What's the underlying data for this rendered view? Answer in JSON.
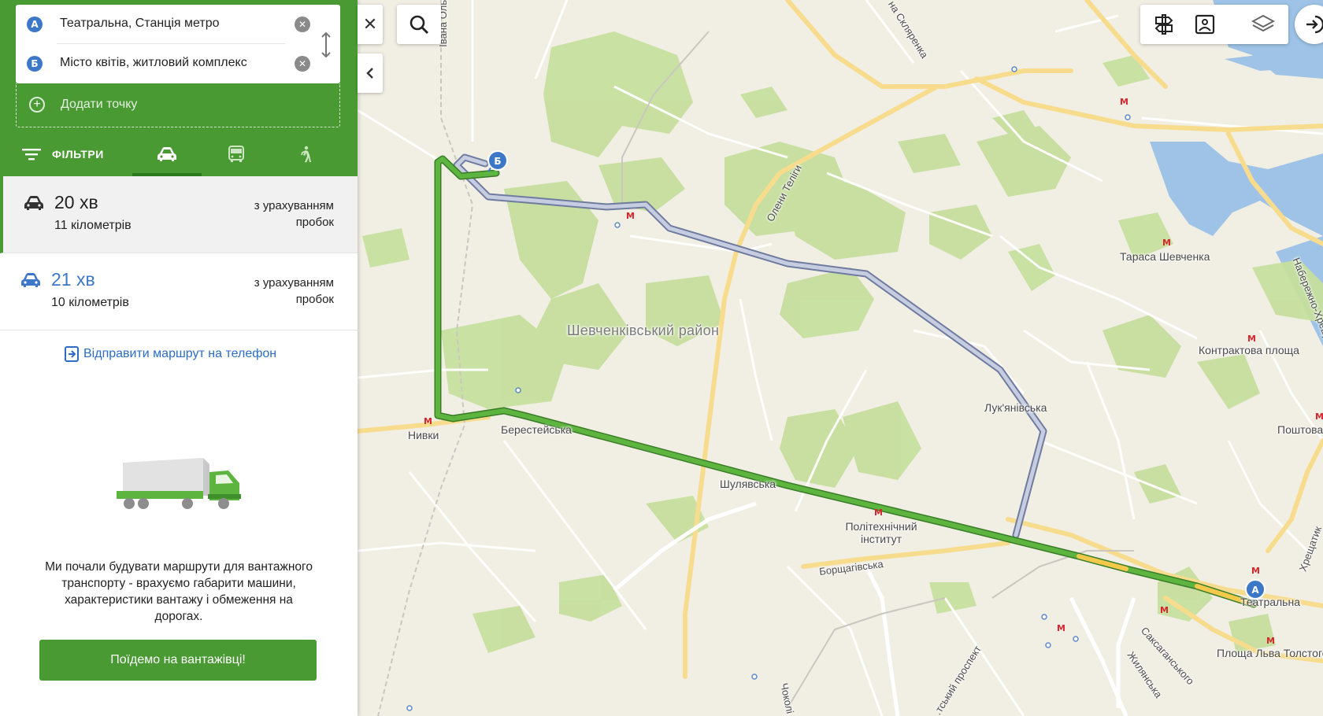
{
  "route_points": {
    "a": {
      "marker": "А",
      "value": "Театральна, Станція метро"
    },
    "b": {
      "marker": "Б",
      "value": "Місто квітів, житловий комплекс"
    },
    "add_label": "Додати точку"
  },
  "tabs": {
    "filters_label": "ФІЛЬТРИ",
    "modes": [
      {
        "name": "car",
        "icon": "car-icon",
        "active": true
      },
      {
        "name": "public-transport",
        "icon": "bus-icon",
        "active": false
      },
      {
        "name": "walk",
        "icon": "pedestrian-icon",
        "active": false
      }
    ]
  },
  "routes": [
    {
      "time": "20 хв",
      "distance": "11 кілометрів",
      "traffic_note": "з урахуванням пробок",
      "selected": true
    },
    {
      "time": "21 хв",
      "distance": "10 кілометрів",
      "traffic_note": "з урахуванням пробок",
      "selected": false
    }
  ],
  "send_to_phone": "Відправити маршрут на телефон",
  "truck_promo": {
    "text": "Ми почали будувати маршрути для вантажного транспорту - врахуємо габарити машини, характеристики вантажу і обмеження на дорогах.",
    "button": "Поїдемо на вантажівці!"
  },
  "map": {
    "labels": {
      "district": "Шевченківський район",
      "nyvky": "Нивки",
      "berestейska": "Берестейська",
      "shuliavska": "Шулявська",
      "polytech": "Політехнічний інститут",
      "lukianivska": "Лук'янівська",
      "borshchahivska": "Борщагівська",
      "teatralna": "Театральна",
      "tarasa": "Тараса Шевченка",
      "kontraktova": "Контрактова площа",
      "poshtova": "Поштова",
      "lva_tolstoho": "Площа Льва Толстого",
      "oleny_telihy": "Олени Теліги",
      "skliarenka": "на Скляренка",
      "ivana": "Івана Ольг",
      "khreshchatyk": "Хрещатик",
      "naberezhno": "Набережно-Хрещ",
      "saksahanskoho": "Саксаганського",
      "zhylianska": "Жилянська",
      "prospekt": "...тський проспект",
      "chokol": "Чоколі"
    }
  },
  "colors": {
    "brand_green": "#4a9a34",
    "active_tab_underline": "#2c7a1e",
    "route_main": "#5db540",
    "route_alt": "#a9afc4",
    "traffic_yellow": "#f4c84b",
    "link_blue": "#2b6dc7",
    "metro_red": "#d6262c"
  }
}
